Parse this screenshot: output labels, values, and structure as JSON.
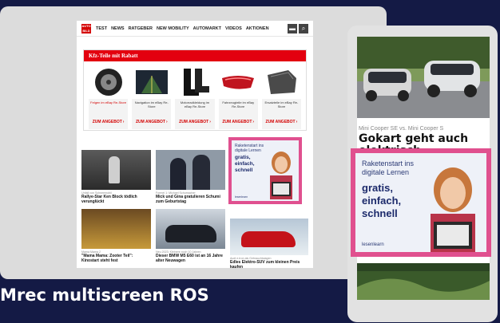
{
  "nav": {
    "logo": "AUTO BILD",
    "items": [
      "TEST",
      "NEWS",
      "RATGEBER",
      "NEW MOBILITY",
      "AUTOMARKT",
      "VIDEOS",
      "AKTIONEN"
    ]
  },
  "promo": {
    "title": "Kfz-Teile mit Rabatt",
    "products": [
      {
        "caption": "Felgen im eBay Re-Store",
        "cta": "ZUM ANGEBOT"
      },
      {
        "caption": "Navigation im eBay Re-Store",
        "cta": "ZUM ANGEBOT"
      },
      {
        "caption": "Motorradkleidung im eBay Re-Store",
        "cta": "ZUM ANGEBOT"
      },
      {
        "caption": "Fahrzeugteile im eBay Re-Store",
        "cta": "ZUM ANGEBOT"
      },
      {
        "caption": "Ersatzteile im eBay Re-Store",
        "cta": "ZUM ANGEBOT"
      }
    ]
  },
  "articles": [
    {
      "meta": "Unfall von Schneemobil",
      "headline": "Rallye-Star Ken Block tödlich verunglückt"
    },
    {
      "meta": "Formel 1: Michael Schumacher",
      "headline": "Mick und Gina gratulieren Schumi zum Geburtstag"
    },
    {
      "meta": "Mama Mama 2",
      "headline": "\"Mama Mama: Zooter Teil\": Kinostart steht fest"
    },
    {
      "meta": "Neu 2023: Kleinere noch 10 Jahren",
      "headline": "Dieser BMW M5 E60 ist an 16 Jahre alter Neuwagen"
    },
    {
      "meta": "Audi e-tron als Gebrauchtwagen",
      "headline": "Edles Elektro-SUV zum kleinen Preis kaufen"
    }
  ],
  "ad": {
    "line1": "Raketenstart ins digitale Lernen",
    "line2a": "gratis,",
    "line2b": "einfach,",
    "line2c": "schnell",
    "brand": "lesenlearn"
  },
  "phone": {
    "kicker": "Mini Cooper SE vs. Mini Cooper S",
    "title": "Gokart geht auch elektrisch"
  },
  "caption": "Mrec multiscreen ROS",
  "colors": {
    "accent": "#e0508f",
    "background": "#141a45",
    "brand_red": "#e3000f"
  }
}
